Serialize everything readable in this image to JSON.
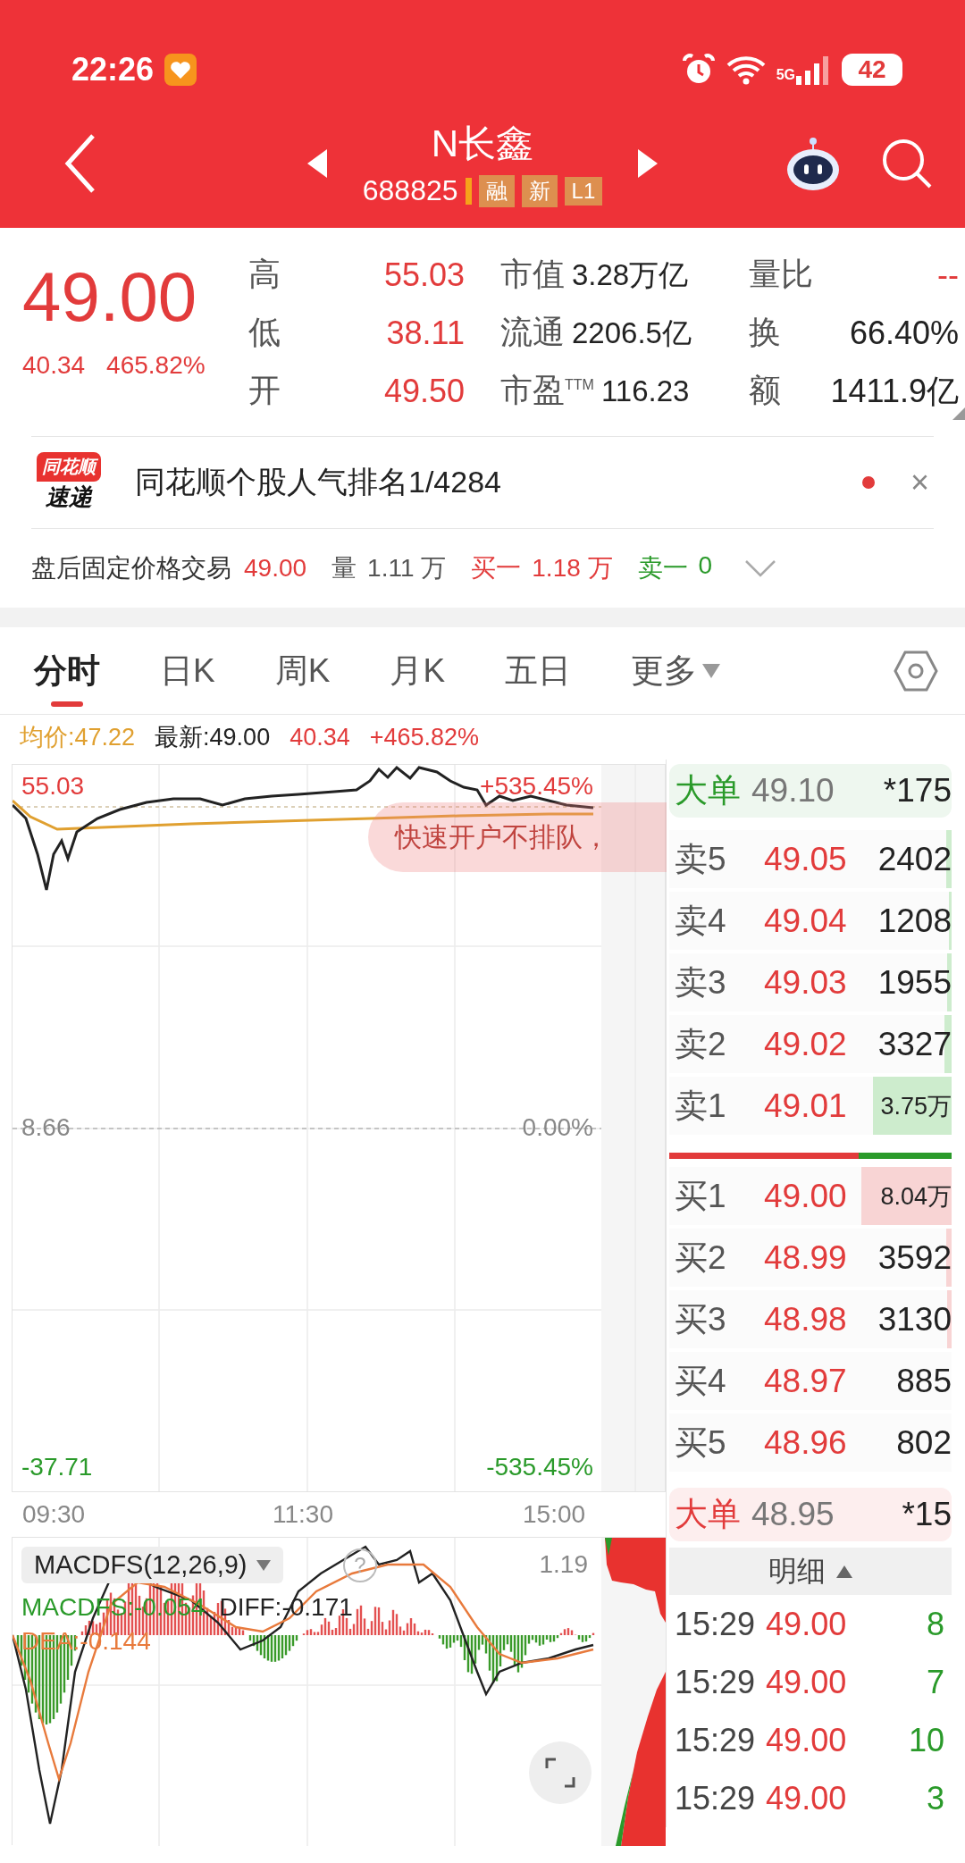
{
  "status_bar": {
    "time": "22:26",
    "network": "5G",
    "battery": "42"
  },
  "header": {
    "title": "N长鑫",
    "code": "688825",
    "tags": [
      "融",
      "新",
      "L1"
    ]
  },
  "quote": {
    "price": "49.00",
    "change": "40.34",
    "change_pct": "465.82%",
    "stats": [
      {
        "label": "高",
        "value": "55.03",
        "kind": "up"
      },
      {
        "label": "市值",
        "value": "3.28万亿",
        "kind": "plain"
      },
      {
        "label": "量比",
        "value": "--",
        "kind": "up"
      },
      {
        "label": "低",
        "value": "38.11",
        "kind": "up"
      },
      {
        "label": "流通",
        "value": "2206.5亿",
        "kind": "plain"
      },
      {
        "label": "换",
        "value": "66.40%",
        "kind": "plain"
      },
      {
        "label": "开",
        "value": "49.50",
        "kind": "up"
      },
      {
        "label": "市盈$^{TTM}$",
        "value": "116.23",
        "kind": "plain"
      },
      {
        "label": "额",
        "value": "1411.9亿",
        "kind": "plain"
      }
    ]
  },
  "news": {
    "logo_top": "同花顺",
    "logo_bottom": "速递",
    "text": "同花顺个股人气排名1/4284",
    "unread": true,
    "close": "×"
  },
  "after_hours": {
    "label": "盘后固定价格交易",
    "price": "49.00",
    "items": [
      {
        "label": "量",
        "value": "1.11 万",
        "kind": "flat"
      },
      {
        "label": "买一",
        "value": "1.18 万",
        "kind": "buy"
      },
      {
        "label": "卖一",
        "value": "0",
        "kind": "sell"
      }
    ]
  },
  "tabs": [
    {
      "label": "分时",
      "selected": true,
      "kind": "tab"
    },
    {
      "label": "日K",
      "selected": false,
      "kind": "tab"
    },
    {
      "label": "周K",
      "selected": false,
      "kind": "tab"
    },
    {
      "label": "月K",
      "selected": false,
      "kind": "tab"
    },
    {
      "label": "五日",
      "selected": false,
      "kind": "tab"
    },
    {
      "label": "更多",
      "selected": false,
      "kind": "menu"
    }
  ],
  "chart_info": {
    "avg": "均价:47.22",
    "latest": "最新:49.00",
    "change": "40.34",
    "change_pct": "+465.82%"
  },
  "intraday_chart": {
    "left_labels": [
      "55.03",
      "8.66",
      "-37.71"
    ],
    "right_labels": [
      "+535.45%",
      "0.00%",
      "-535.45%"
    ],
    "banner": "快速开户不排队，",
    "times": [
      "09:30",
      "11:30",
      "15:00"
    ]
  },
  "order_book": {
    "big_sell": {
      "label": "大单",
      "price": "49.10",
      "volume": "*175"
    },
    "asks": [
      {
        "label": "卖5",
        "price": "49.05",
        "volume": "2402",
        "level": 0.02
      },
      {
        "label": "卖4",
        "price": "49.04",
        "volume": "1208",
        "level": 0.01
      },
      {
        "label": "卖3",
        "price": "49.03",
        "volume": "1955",
        "level": 0.015
      },
      {
        "label": "卖2",
        "price": "49.02",
        "volume": "3327",
        "level": 0.025
      },
      {
        "label": "卖1",
        "price": "49.01",
        "volume": "3.75万",
        "level": 0.28
      }
    ],
    "split": {
      "level": 0.67
    },
    "bids": [
      {
        "label": "买1",
        "price": "49.00",
        "volume": "8.04万",
        "level": 0.32
      },
      {
        "label": "买2",
        "price": "48.99",
        "volume": "3592",
        "level": 0.02
      },
      {
        "label": "买3",
        "price": "48.98",
        "volume": "3130",
        "level": 0.015
      },
      {
        "label": "买4",
        "price": "48.97",
        "volume": "885",
        "level": 0
      },
      {
        "label": "买5",
        "price": "48.96",
        "volume": "802",
        "level": 0
      }
    ],
    "big_buy": {
      "label": "大单",
      "price": "48.95",
      "volume": "*15"
    }
  },
  "macd": {
    "title": "MACDFS(12,26,9)",
    "help": "?",
    "max": "1.19",
    "macdfs": "MACDFS:-0.054",
    "diff": "DIFF:-0.171",
    "dea": "DEA:-0.144"
  },
  "trade_detail": {
    "title": "明细",
    "rows": [
      {
        "time": "15:29",
        "price": "49.00",
        "volume": "8",
        "kind": "sell"
      },
      {
        "time": "15:29",
        "price": "49.00",
        "volume": "7",
        "kind": "sell"
      },
      {
        "time": "15:29",
        "price": "49.00",
        "volume": "10",
        "kind": "sell"
      },
      {
        "time": "15:29",
        "price": "49.00",
        "volume": "3",
        "kind": "sell"
      }
    ]
  }
}
